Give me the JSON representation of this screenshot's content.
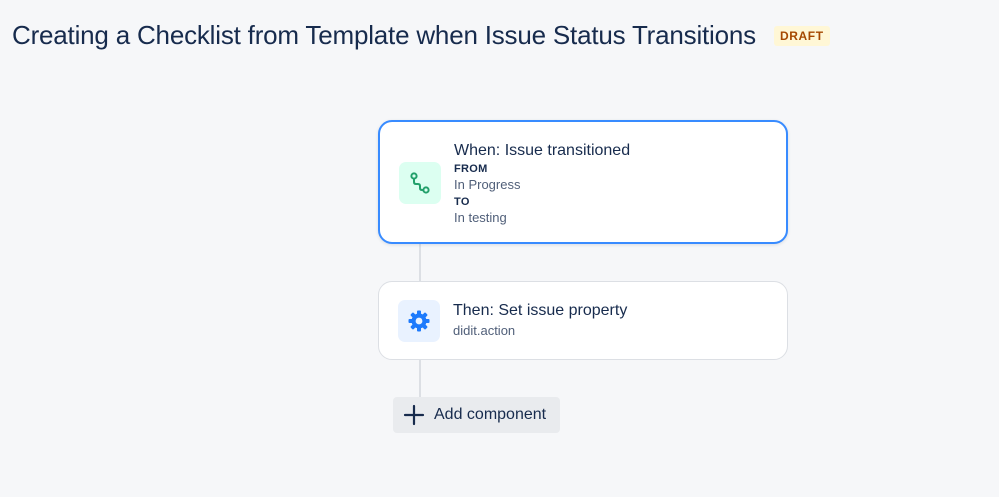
{
  "header": {
    "title": "Creating a Checklist from Template when Issue Status Transitions",
    "status_badge": "DRAFT"
  },
  "rule": {
    "trigger": {
      "icon": "transition-icon",
      "heading": "When: Issue transitioned",
      "from_label": "FROM",
      "from_value": "In Progress",
      "to_label": "TO",
      "to_value": "In testing"
    },
    "action": {
      "icon": "gear-icon",
      "heading": "Then: Set issue property",
      "detail": "didit.action"
    },
    "add_component": {
      "icon": "plus-icon",
      "label": "Add component"
    }
  },
  "colors": {
    "accent": "#388bff",
    "trigger_icon": "#22a06b",
    "action_icon": "#1d7afc",
    "draft_badge_bg": "#fff7d6",
    "draft_badge_text": "#a54800"
  }
}
